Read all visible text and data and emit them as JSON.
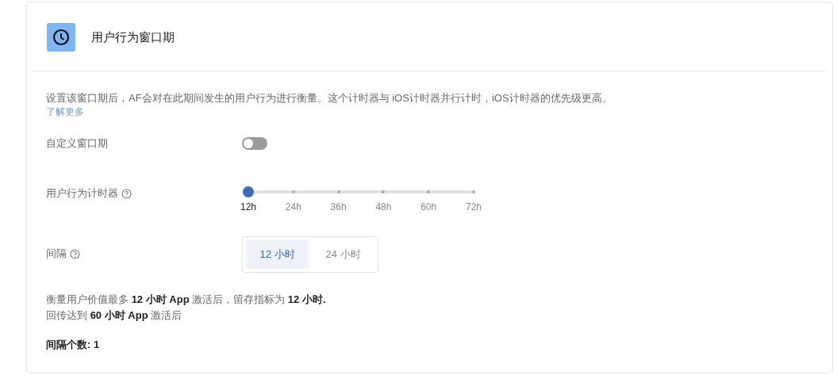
{
  "card": {
    "title": "用户行为窗口期",
    "description": "设置该窗口期后，AF会对在此期间发生的用户行为进行衡量。这个计时器与 iOS计时器并行计时，iOS计时器的优先级更高。",
    "learn_more": "了解更多",
    "custom_window": {
      "label": "自定义窗口期",
      "on": false
    },
    "timer": {
      "label": "用户行为计时器",
      "level": 0,
      "ticks": [
        {
          "label": "12h",
          "selected": true
        },
        {
          "label": "24h",
          "selected": false
        },
        {
          "label": "36h",
          "selected": false
        },
        {
          "label": "48h",
          "selected": false
        },
        {
          "label": "60h",
          "selected": false
        },
        {
          "label": "72h",
          "selected": false
        }
      ]
    },
    "interval": {
      "label": "间隔",
      "options": [
        {
          "label": "12 小时",
          "selected": true
        },
        {
          "label": "24 小时",
          "selected": false
        }
      ]
    },
    "summary": [
      "衡量用户价值最多 **12 小时 App** 激活后，留存指标为 **12 小时.**",
      "回传达到 **60 小时 App** 激活后"
    ],
    "count": "间隔个数: 1"
  }
}
